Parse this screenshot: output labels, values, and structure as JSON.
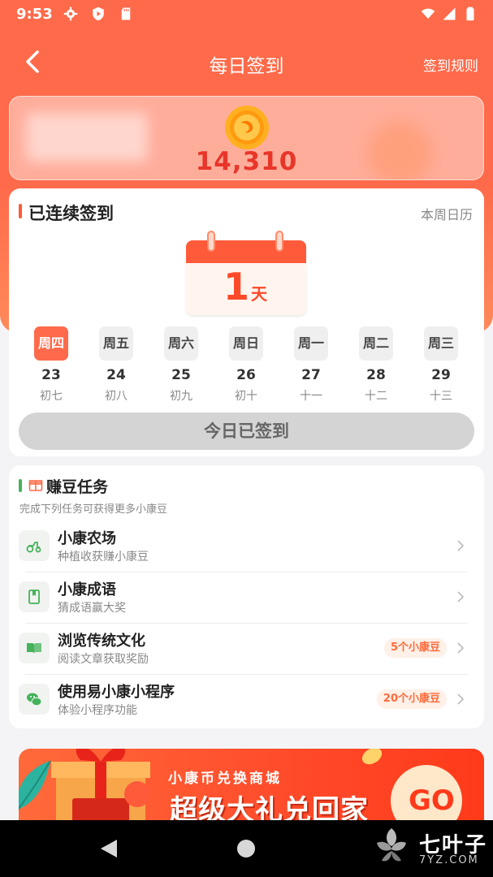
{
  "status_bar": {
    "time": "9:53"
  },
  "header": {
    "title": "每日签到",
    "rules": "签到规则"
  },
  "coins": {
    "amount": "14,310"
  },
  "checkin": {
    "title": "已连续签到",
    "week_calendar": "本周日历",
    "streak_days": "1",
    "streak_unit": "天",
    "days": [
      {
        "weekday": "周四",
        "date": "23",
        "lunar": "初七",
        "active": true
      },
      {
        "weekday": "周五",
        "date": "24",
        "lunar": "初八",
        "active": false
      },
      {
        "weekday": "周六",
        "date": "25",
        "lunar": "初九",
        "active": false
      },
      {
        "weekday": "周日",
        "date": "26",
        "lunar": "初十",
        "active": false
      },
      {
        "weekday": "周一",
        "date": "27",
        "lunar": "十一",
        "active": false
      },
      {
        "weekday": "周二",
        "date": "28",
        "lunar": "十二",
        "active": false
      },
      {
        "weekday": "周三",
        "date": "29",
        "lunar": "十三",
        "active": false
      }
    ],
    "button": "今日已签到"
  },
  "tasks": {
    "title": "赚豆任务",
    "subtitle": "完成下列任务可获得更多小康豆",
    "items": [
      {
        "name": "小康农场",
        "desc": "种植收获赚小康豆",
        "reward": "",
        "icon": "tractor-icon"
      },
      {
        "name": "小康成语",
        "desc": "猜成语赢大奖",
        "reward": "",
        "icon": "book-icon"
      },
      {
        "name": "浏览传统文化",
        "desc": "阅读文章获取奖励",
        "reward": "5个小康豆",
        "icon": "open-book-icon"
      },
      {
        "name": "使用易小康小程序",
        "desc": "体验小程序功能",
        "reward": "20个小康豆",
        "icon": "wechat-icon"
      }
    ]
  },
  "banner": {
    "subtitle": "小康币兑换商城",
    "title": "超级大礼兑回家",
    "go": "GO"
  },
  "watermark": {
    "name": "七叶子",
    "site": "7YZ.COM"
  },
  "colors": {
    "primary": "#ff6a4a",
    "accent_red": "#e8362a",
    "task_green": "#44b35a",
    "reward_bg": "#fff0e8"
  }
}
